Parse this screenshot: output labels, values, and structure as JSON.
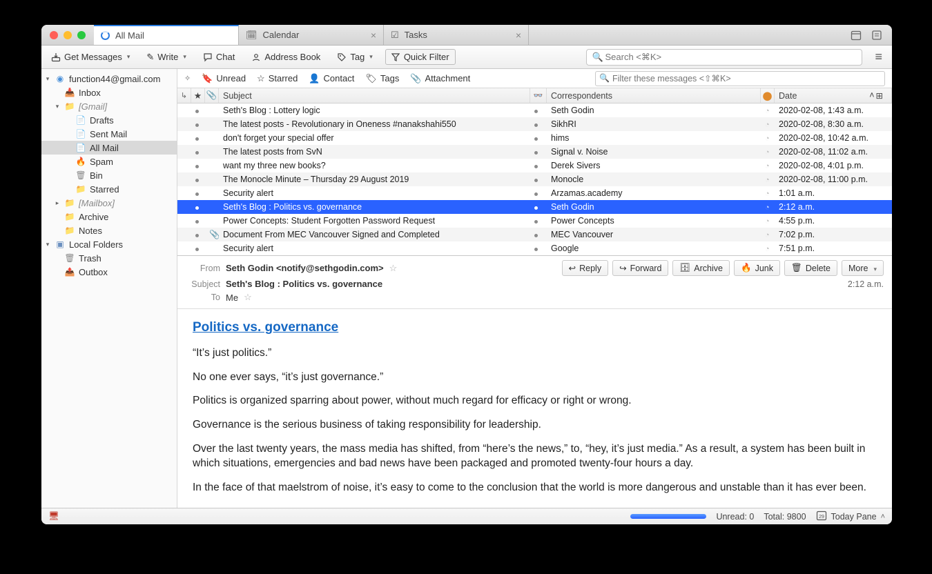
{
  "tabs": [
    {
      "label": "All Mail",
      "active": true,
      "closable": false,
      "kind": "mail"
    },
    {
      "label": "Calendar",
      "active": false,
      "closable": true,
      "kind": "calendar"
    },
    {
      "label": "Tasks",
      "active": false,
      "closable": true,
      "kind": "tasks"
    }
  ],
  "toolbar": {
    "get_messages": "Get Messages",
    "write": "Write",
    "chat": "Chat",
    "address_book": "Address Book",
    "tag": "Tag",
    "quick_filter": "Quick Filter",
    "search_placeholder": "Search <⌘K>"
  },
  "filterbar": {
    "unread": "Unread",
    "starred": "Starred",
    "contact": "Contact",
    "tags": "Tags",
    "attachment": "Attachment",
    "filter_placeholder": "Filter these messages <⇧⌘K>"
  },
  "columns": {
    "subject": "Subject",
    "correspondents": "Correspondents",
    "date": "Date"
  },
  "sidebar": {
    "account": "function44@gmail.com",
    "items": [
      {
        "label": "Inbox",
        "indent": 2,
        "icon": "inbox"
      },
      {
        "label": "[Gmail]",
        "indent": 2,
        "icon": "folder",
        "muted": true,
        "expandable": true,
        "expanded": true
      },
      {
        "label": "Drafts",
        "indent": 3,
        "icon": "file"
      },
      {
        "label": "Sent Mail",
        "indent": 3,
        "icon": "file"
      },
      {
        "label": "All Mail",
        "indent": 3,
        "icon": "file",
        "selected": true
      },
      {
        "label": "Spam",
        "indent": 3,
        "icon": "spam"
      },
      {
        "label": "Bin",
        "indent": 3,
        "icon": "trash"
      },
      {
        "label": "Starred",
        "indent": 3,
        "icon": "folder"
      },
      {
        "label": "[Mailbox]",
        "indent": 2,
        "icon": "folder",
        "muted": true,
        "expandable": true,
        "expanded": false
      },
      {
        "label": "Archive",
        "indent": 2,
        "icon": "folder"
      },
      {
        "label": "Notes",
        "indent": 2,
        "icon": "folder"
      }
    ],
    "local_label": "Local Folders",
    "local_items": [
      {
        "label": "Trash",
        "indent": 2,
        "icon": "trash"
      },
      {
        "label": "Outbox",
        "indent": 2,
        "icon": "outbox"
      }
    ]
  },
  "messages": [
    {
      "subject": "Seth's Blog : Lottery logic",
      "from": "Seth Godin",
      "date": "2020-02-08, 1:43 a.m.",
      "selected": false,
      "att": false
    },
    {
      "subject": "The latest posts - Revolutionary in Oneness #nanakshahi550",
      "from": "SikhRI",
      "date": "2020-02-08, 8:30 a.m.",
      "selected": false,
      "att": false
    },
    {
      "subject": "don't forget your special offer",
      "from": "hims",
      "date": "2020-02-08, 10:42 a.m.",
      "selected": false,
      "att": false
    },
    {
      "subject": "The latest posts from SvN",
      "from": "Signal v. Noise",
      "date": "2020-02-08, 11:02 a.m.",
      "selected": false,
      "att": false
    },
    {
      "subject": "want my three new books?",
      "from": "Derek Sivers",
      "date": "2020-02-08, 4:01 p.m.",
      "selected": false,
      "att": false
    },
    {
      "subject": "The Monocle Minute – Thursday 29 August 2019",
      "from": "Monocle",
      "date": "2020-02-08, 11:00 p.m.",
      "selected": false,
      "att": false
    },
    {
      "subject": "Security alert",
      "from": "Arzamas.academy",
      "date": "1:01 a.m.",
      "selected": false,
      "att": false
    },
    {
      "subject": "Seth's Blog : Politics vs. governance",
      "from": "Seth Godin",
      "date": "2:12 a.m.",
      "selected": true,
      "att": false
    },
    {
      "subject": "Power Concepts: Student Forgotten Password Request",
      "from": "Power Concepts",
      "date": "4:55 p.m.",
      "selected": false,
      "att": false
    },
    {
      "subject": "Document From MEC Vancouver Signed and Completed",
      "from": "MEC Vancouver",
      "date": "7:02 p.m.",
      "selected": false,
      "att": true
    },
    {
      "subject": "Security alert",
      "from": "Google",
      "date": "7:51 p.m.",
      "selected": false,
      "att": false
    }
  ],
  "preview": {
    "from_label": "From",
    "subject_label": "Subject",
    "to_label": "To",
    "from": "Seth Godin <notify@sethgodin.com>",
    "subject": "Seth's Blog : Politics vs. governance",
    "to": "Me",
    "time": "2:12 a.m.",
    "actions": {
      "reply": "Reply",
      "forward": "Forward",
      "archive": "Archive",
      "junk": "Junk",
      "delete": "Delete",
      "more": "More"
    },
    "body_title": "Politics vs. governance",
    "paragraphs": [
      "“It’s just politics.”",
      "No one ever says, “it’s just governance.”",
      "Politics is organized sparring about power, without much regard for efficacy or right or wrong.",
      "Governance is the serious business of taking responsibility for leadership.",
      "Over the last twenty years, the mass media has shifted, from “here’s the news,” to, “hey, it’s just media.” As a result, a system has been built in which situations, emergencies and bad news have been packaged and promoted twenty-four hours a day.",
      "In the face of that maelstrom of noise, it’s easy to come to the conclusion that the world is more dangerous and unstable than it has ever been."
    ]
  },
  "status": {
    "unread_label": "Unread: 0",
    "total_label": "Total: 9800",
    "today_pane": "Today Pane"
  }
}
